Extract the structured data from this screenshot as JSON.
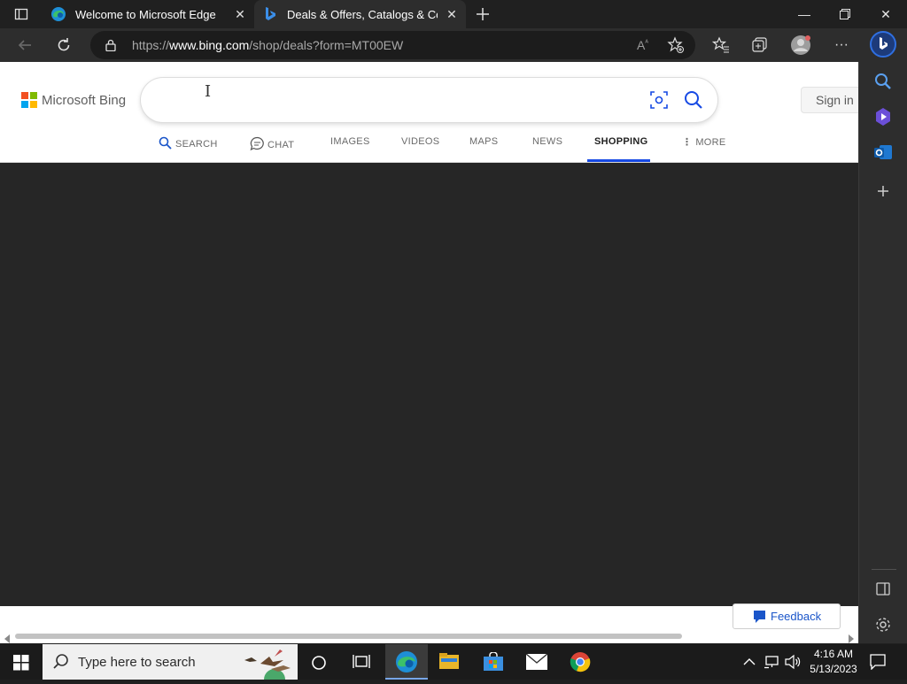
{
  "browser": {
    "tabs": [
      {
        "title": "Welcome to Microsoft Edge"
      },
      {
        "title": "Deals & Offers, Catalogs & Coup"
      }
    ],
    "address": {
      "prefix": "https://",
      "domain": "www.bing.com",
      "path": "/shop/deals?form=MT00EW"
    }
  },
  "bing": {
    "logo_text": "Microsoft Bing",
    "search_value": "",
    "sign_in": "Sign in",
    "nav": {
      "search": "SEARCH",
      "chat": "CHAT",
      "images": "IMAGES",
      "videos": "VIDEOS",
      "maps": "MAPS",
      "news": "NEWS",
      "shopping": "SHOPPING",
      "more": "MORE"
    },
    "active_tab": "SHOPPING",
    "feedback": "Feedback"
  },
  "taskbar": {
    "search_placeholder": "Type here to search",
    "time": "4:16 AM",
    "date": "5/13/2023"
  },
  "colors": {
    "accent": "#174ae4",
    "chrome_dark": "#202020",
    "toolbar": "#2d2d2d"
  }
}
